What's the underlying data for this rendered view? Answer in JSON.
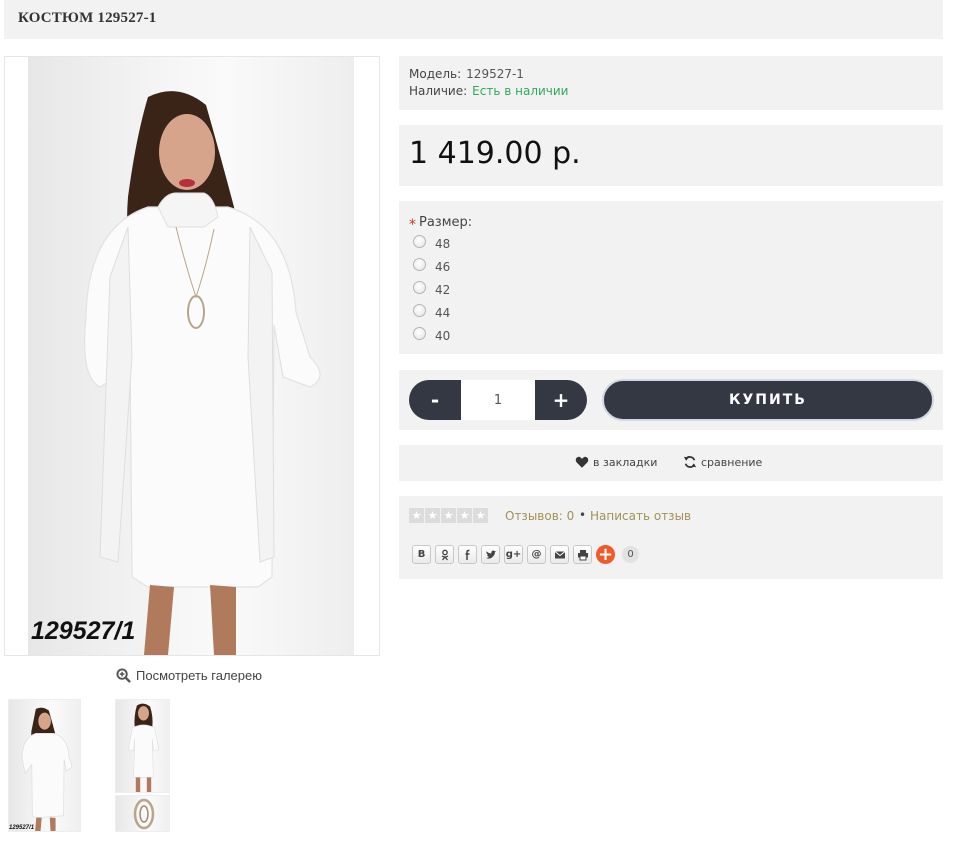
{
  "product": {
    "title": "КОСТЮМ 129527-1",
    "photo_code": "129527/1",
    "thumb_code": "129527/1"
  },
  "gallery": {
    "view_label": "Посмотреть галерею"
  },
  "info": {
    "model_label": "Модель:",
    "model_value": "129527-1",
    "stock_label": "Наличие:",
    "stock_value": "Есть в наличии"
  },
  "price": {
    "amount": "1 419.00 р."
  },
  "options": {
    "required_mark": "*",
    "size_label": "Размер:",
    "sizes": [
      "48",
      "46",
      "42",
      "44",
      "40"
    ]
  },
  "cart": {
    "minus_label": "-",
    "quantity": "1",
    "plus_label": "+",
    "buy_label": "КУПИТЬ"
  },
  "actions": {
    "bookmark_label": "в закладки",
    "compare_label": "сравнение"
  },
  "reviews": {
    "rating": 0,
    "max_rating": 5,
    "count_label": "Отзывов: 0",
    "separator": "•",
    "write_label": "Написать отзыв"
  },
  "share": {
    "vk_label": "В",
    "gplus_label": "g+",
    "at_label": "@",
    "count": "0"
  },
  "colors": {
    "panel_bg": "#f2f2f2",
    "dark_button": "#343842",
    "in_stock": "#2eaa5c",
    "review_link": "#a49157",
    "required": "#e02c2c",
    "share_plus": "#f0592a"
  }
}
